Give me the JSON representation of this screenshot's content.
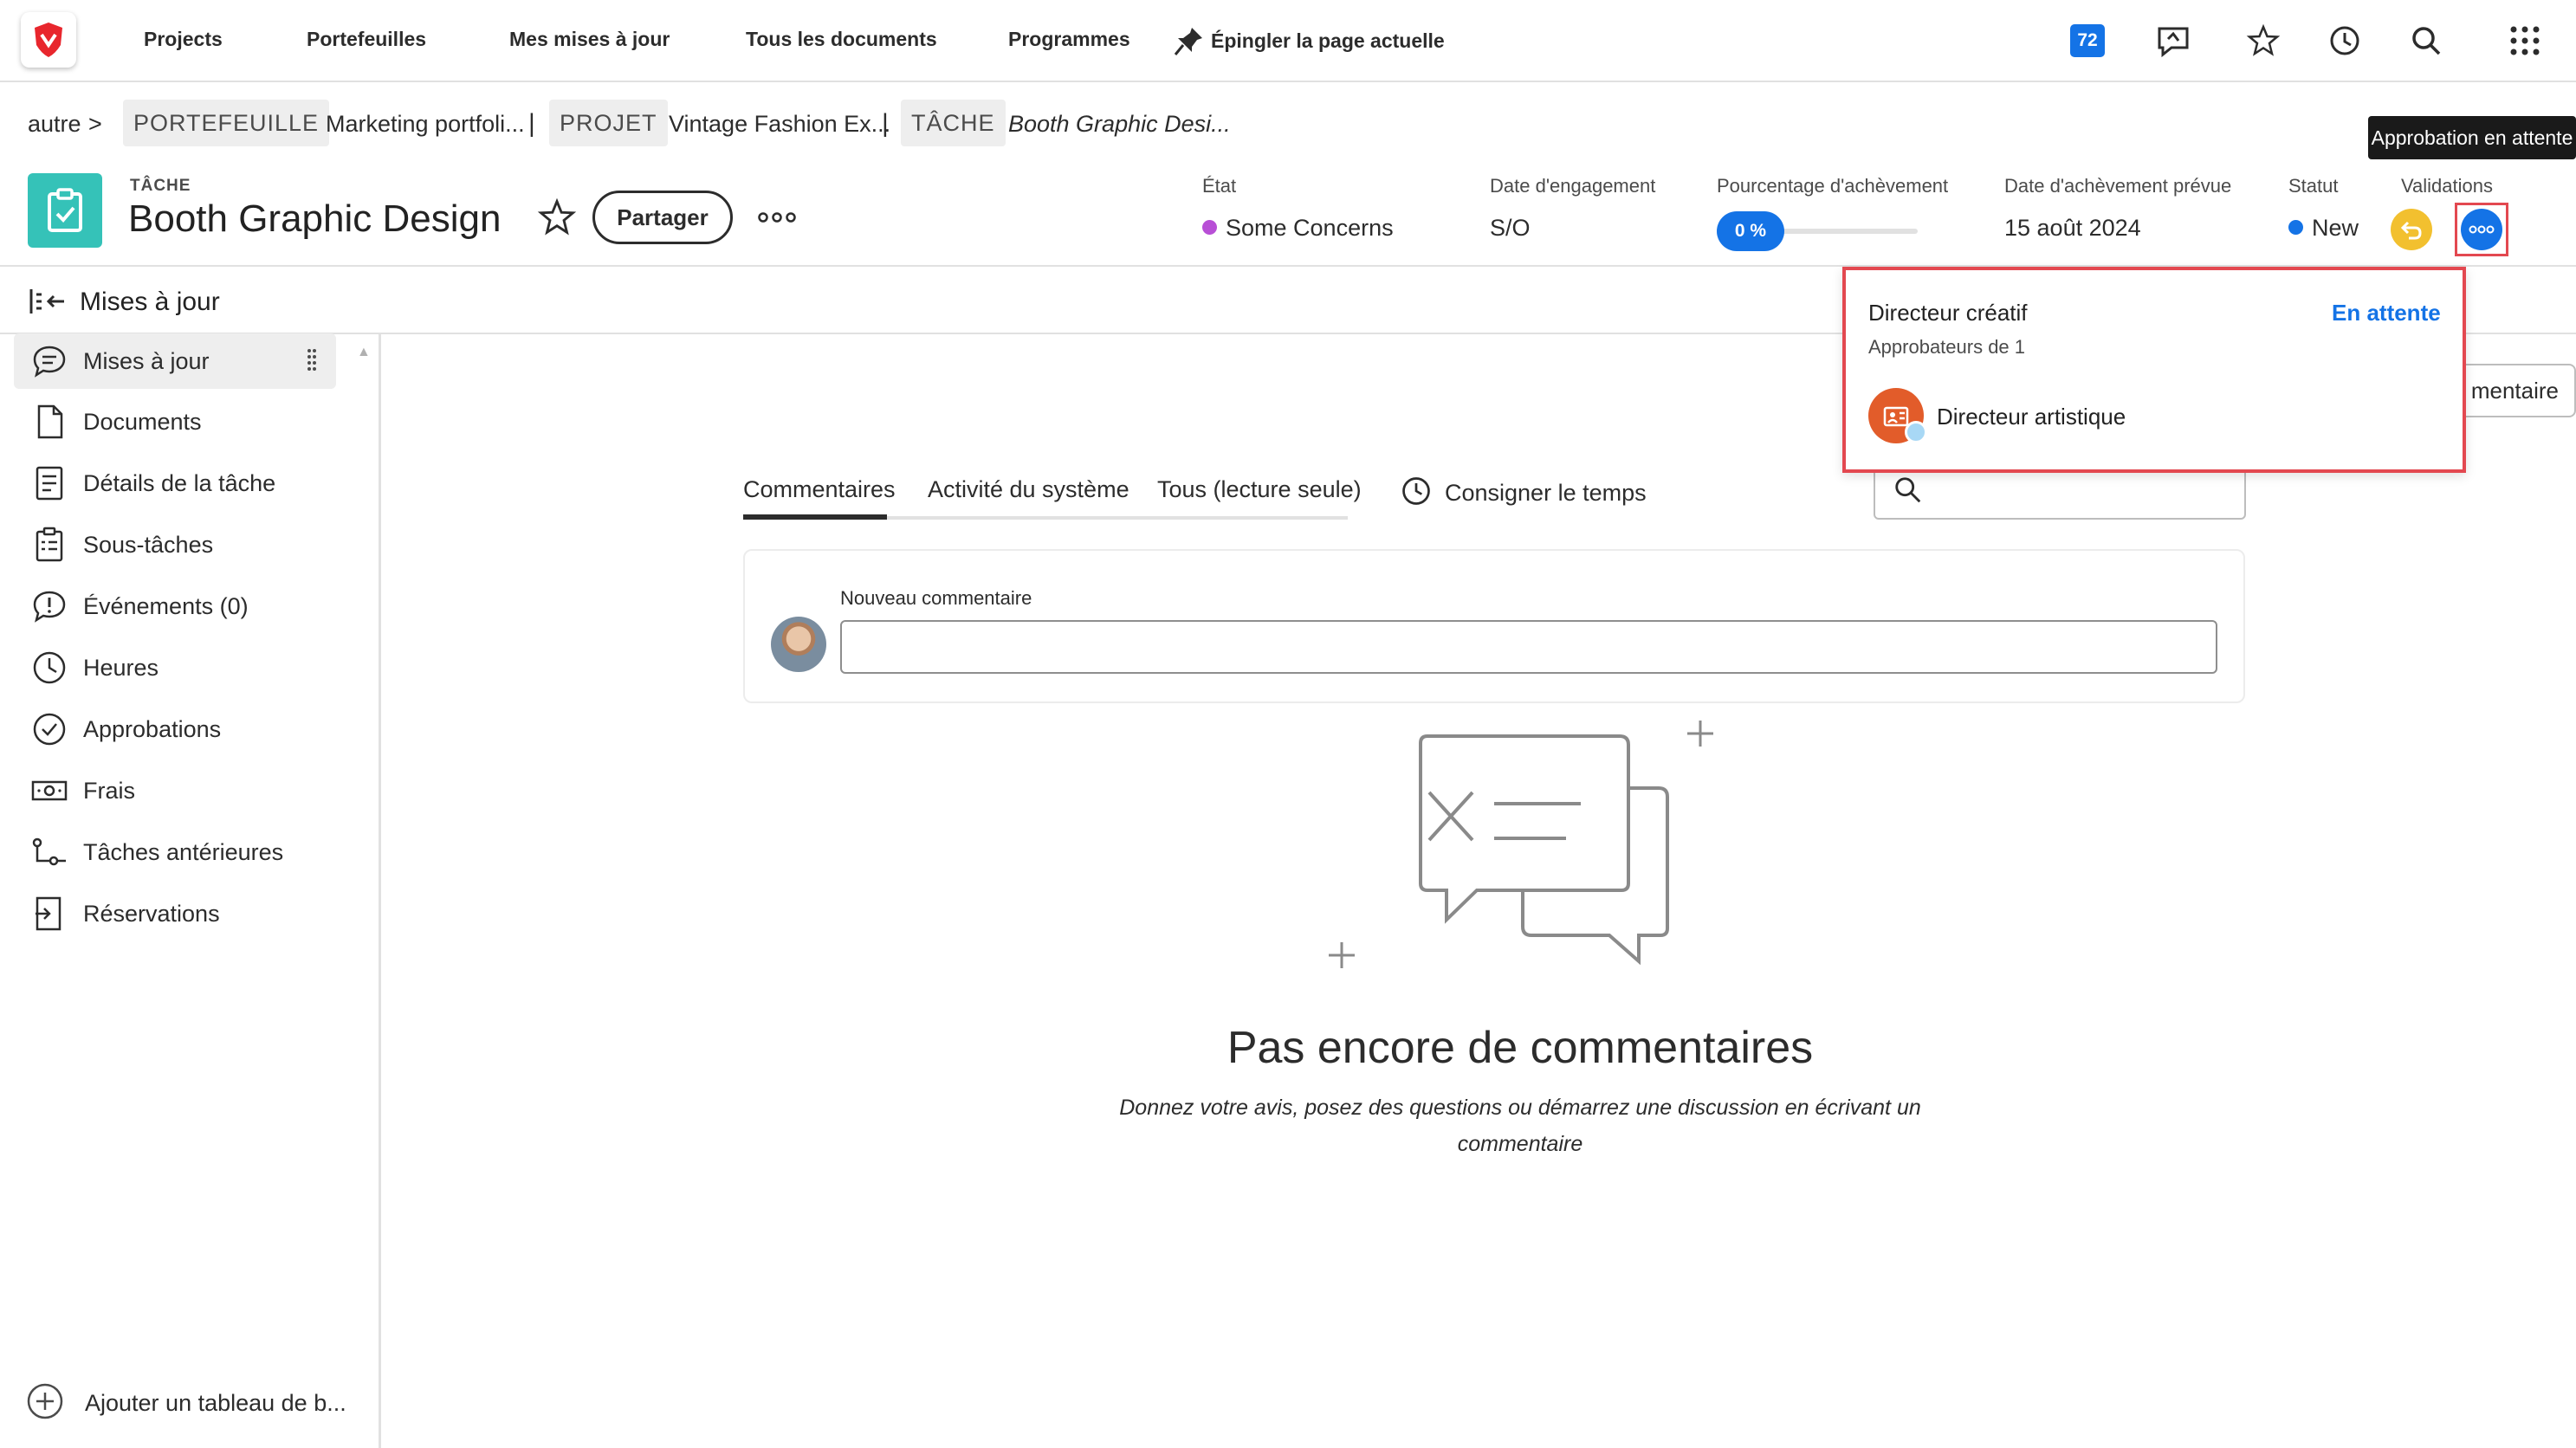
{
  "nav": {
    "items": [
      "Projects",
      "Portefeuilles",
      "Mes mises à jour",
      "Tous les documents",
      "Programmes"
    ],
    "pin_label": "Épingler la page actuelle",
    "notification_count": "72"
  },
  "breadcrumb": {
    "root": "autre",
    "arrow": ">",
    "portfolio_tag": "PORTEFEUILLE",
    "portfolio_name": "Marketing portfoli...",
    "project_tag": "PROJET",
    "project_name": "Vintage Fashion Ex...",
    "task_tag": "TÂCHE",
    "task_name": "Booth Graphic Desi...",
    "separator": "|"
  },
  "header": {
    "object_type": "TÂCHE",
    "title": "Booth Graphic Design",
    "share_label": "Partager",
    "fields": {
      "condition_label": "État",
      "condition_value": "Some Concerns",
      "commit_label": "Date d'engagement",
      "commit_value": "S/O",
      "percent_label": "Pourcentage d'achèvement",
      "percent_value": "0 %",
      "percent_fraction": 0,
      "planned_label": "Date d'achèvement prévue",
      "planned_value": "15 août 2024",
      "status_label": "Statut",
      "status_value": "New",
      "approvals_label": "Validations"
    },
    "tooltip": "Approbation en attente"
  },
  "colors": {
    "condition_dot": "#b84fd6",
    "status_dot": "#1473e6",
    "accent": "#1473e6",
    "task_icon": "#35c2b8",
    "highlight": "#e34850"
  },
  "panel": {
    "title": "Mises à jour"
  },
  "sidebar": {
    "items": [
      {
        "label": "Mises à jour",
        "icon": "chat-bubble-icon"
      },
      {
        "label": "Documents",
        "icon": "document-icon"
      },
      {
        "label": "Détails de la tâche",
        "icon": "details-icon"
      },
      {
        "label": "Sous-tâches",
        "icon": "subtasks-icon"
      },
      {
        "label": "Événements (0)",
        "icon": "issue-icon"
      },
      {
        "label": "Heures",
        "icon": "clock-icon"
      },
      {
        "label": "Approbations",
        "icon": "checkmark-circle-icon"
      },
      {
        "label": "Frais",
        "icon": "money-icon"
      },
      {
        "label": "Tâches antérieures",
        "icon": "predecessors-icon"
      },
      {
        "label": "Réservations",
        "icon": "booking-icon"
      }
    ],
    "add_board": "Ajouter un tableau de b..."
  },
  "tabs": {
    "comments": "Commentaires",
    "system": "Activité du système",
    "all": "Tous (lecture seule)",
    "log_time": "Consigner le temps"
  },
  "comment": {
    "label": "Nouveau commentaire",
    "value": "",
    "partial_button": "mentaire"
  },
  "empty_state": {
    "title": "Pas encore de commentaires",
    "description": "Donnez votre avis, posez des questions ou démarrez une discussion en écrivant un commentaire"
  },
  "popover": {
    "role": "Directeur créatif",
    "status": "En attente",
    "subtitle": "Approbateurs de 1",
    "approver": "Directeur artistique"
  }
}
